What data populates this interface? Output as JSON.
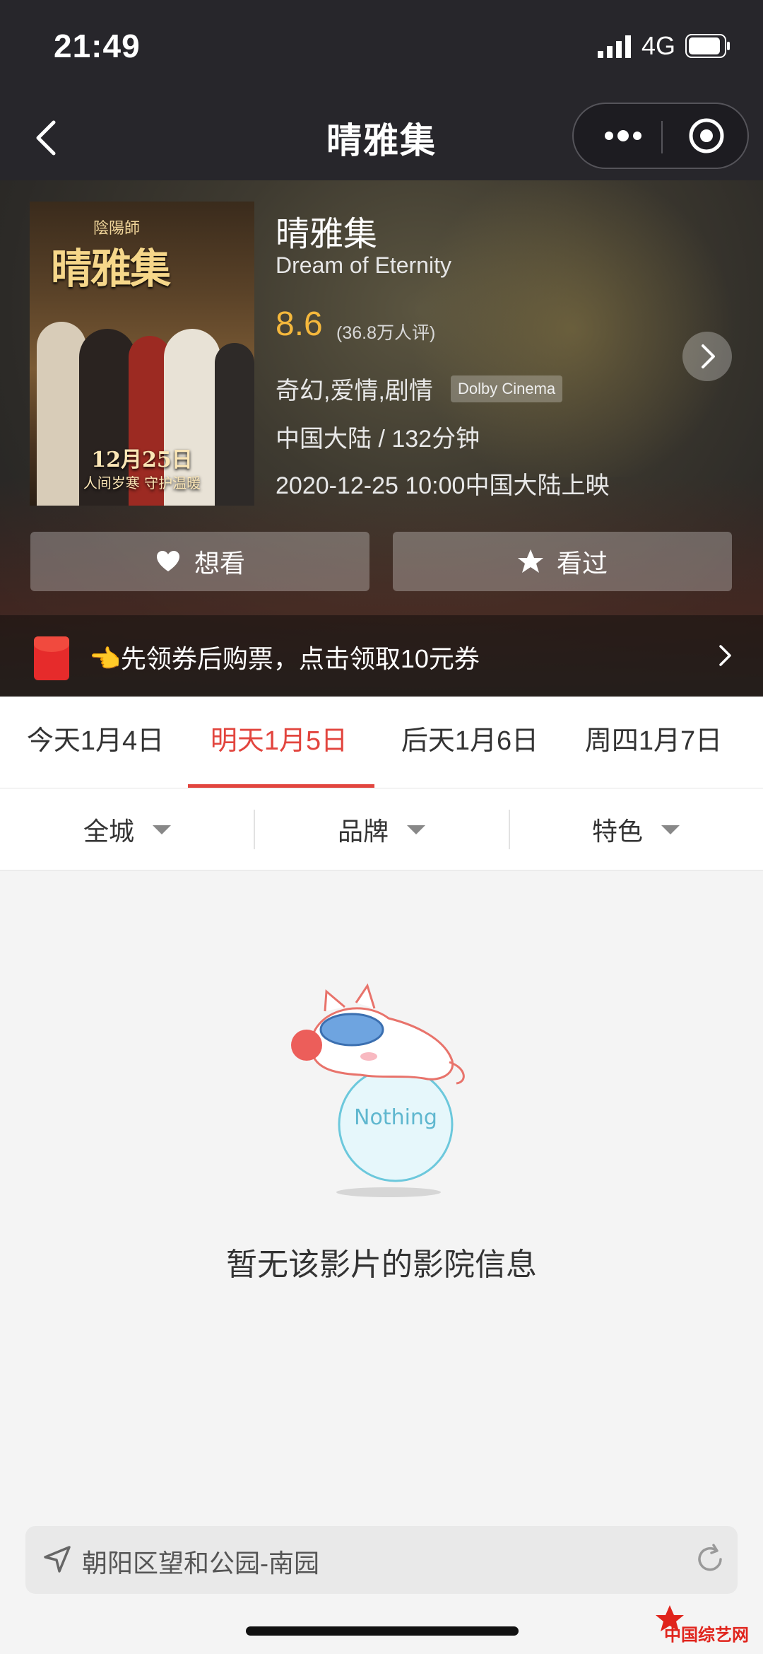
{
  "status_bar": {
    "time": "21:49",
    "network": "4G"
  },
  "nav": {
    "title": "晴雅集"
  },
  "poster": {
    "sub": "陰陽師",
    "title": "晴雅集",
    "date": "12月25日",
    "tagline": "人间岁寒 守护温暖"
  },
  "movie": {
    "title": "晴雅集",
    "english_title": "Dream of Eternity",
    "score": "8.6",
    "score_count": "(36.8万人评)",
    "genres": "奇幻,爱情,剧情",
    "format": "Dolby Cinema",
    "region_duration": "中国大陆 / 132分钟",
    "release": "2020-12-25 10:00中国大陆上映"
  },
  "actions": {
    "want": "想看",
    "watched": "看过"
  },
  "coupon": {
    "text": "👈先领券后购票，点击领取10元券"
  },
  "date_tabs": [
    {
      "label": "今天1月4日",
      "active": false
    },
    {
      "label": "明天1月5日",
      "active": true
    },
    {
      "label": "后天1月6日",
      "active": false
    },
    {
      "label": "周四1月7日",
      "active": false
    }
  ],
  "filters": [
    "全城",
    "品牌",
    "特色"
  ],
  "empty_state": {
    "illustration_text": "Nothing",
    "message": "暂无该影片的影院信息"
  },
  "location": {
    "address": "朝阳区望和公园-南园"
  },
  "watermark": {
    "text": "中国综艺网"
  },
  "colors": {
    "accent": "#e2453e",
    "score": "#f5b83c",
    "header_bg": "#27262b"
  }
}
